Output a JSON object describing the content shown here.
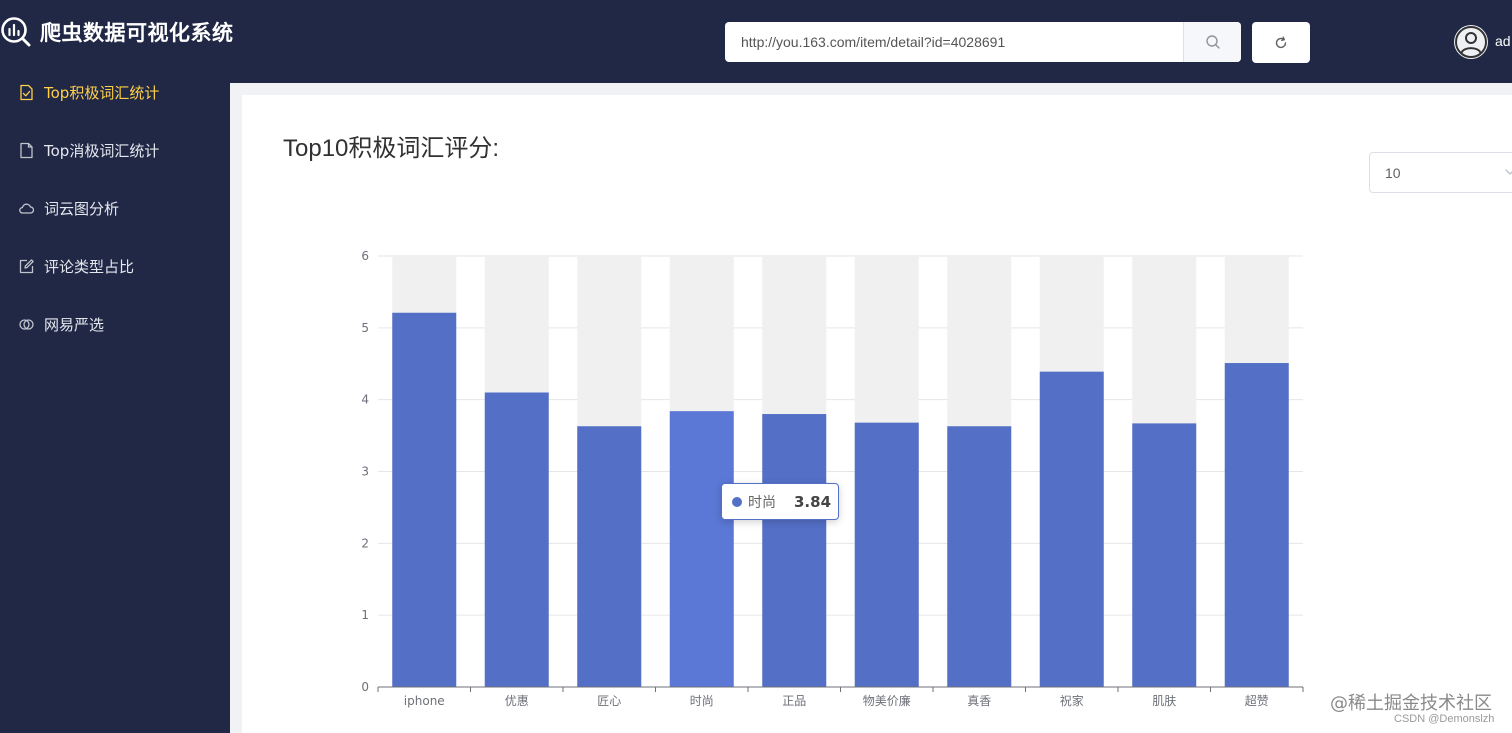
{
  "header": {
    "app_title": "爬虫数据可视化系统",
    "url_value": "http://you.163.com/item/detail?id=4028691",
    "username": "ad"
  },
  "sidebar": {
    "items": [
      {
        "label": "Top积极词汇统计",
        "icon": "document-check-icon",
        "active": true
      },
      {
        "label": "Top消极词汇统计",
        "icon": "document-icon",
        "active": false
      },
      {
        "label": "词云图分析",
        "icon": "cloud-icon",
        "active": false
      },
      {
        "label": "评论类型占比",
        "icon": "edit-icon",
        "active": false
      },
      {
        "label": "网易严选",
        "icon": "link-icon",
        "active": false
      }
    ]
  },
  "main": {
    "title": "Top10积极词汇评分:",
    "select_value": "10"
  },
  "chart_data": {
    "type": "bar",
    "title": "",
    "xlabel": "",
    "ylabel": "",
    "categories": [
      "iphone",
      "优惠",
      "匠心",
      "时尚",
      "正品",
      "物美价廉",
      "真香",
      "祝家",
      "肌肤",
      "超赞"
    ],
    "values": [
      5.21,
      4.1,
      3.63,
      3.84,
      3.8,
      3.68,
      3.63,
      4.39,
      3.67,
      4.51
    ],
    "ylim": [
      0,
      6
    ],
    "yticks": [
      0,
      1,
      2,
      3,
      4,
      5,
      6
    ],
    "grid": true,
    "background_bars": true,
    "bar_color": "#5470c6",
    "highlight_color": "#5b78d6",
    "background_color": "#f0f0f0",
    "highlight_index": 3,
    "tooltip": {
      "label": "时尚",
      "value": "3.84"
    }
  },
  "watermark": {
    "text": "@稀土掘金技术社区",
    "sub": "CSDN @Demonslzh"
  },
  "colors": {
    "header_bg": "#202845",
    "active_menu": "#ffd04b",
    "accent": "#5470c6"
  }
}
